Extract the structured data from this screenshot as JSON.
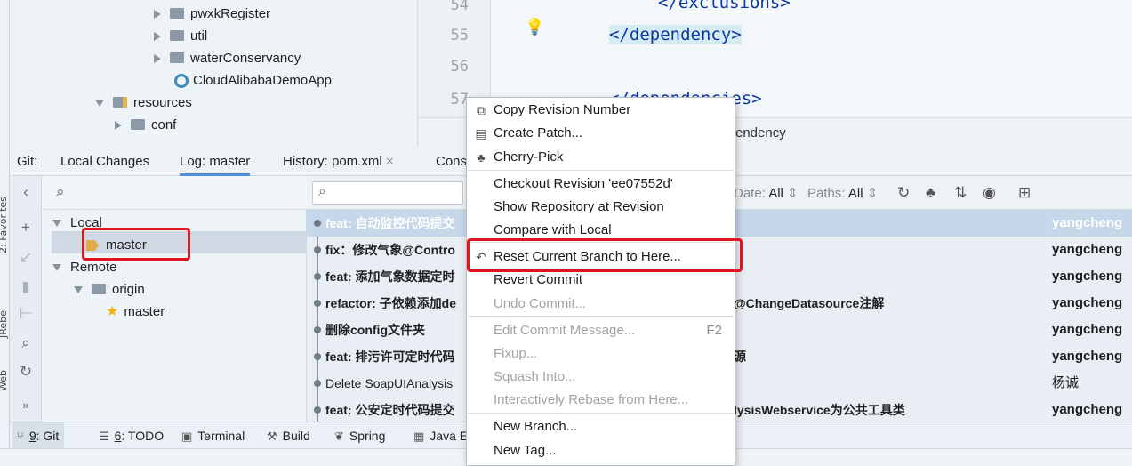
{
  "side_labels": {
    "favorites": "2: Favorites",
    "jrebel": "JRebel",
    "web": "Web"
  },
  "project_tree": [
    {
      "label": "pwxkRegister",
      "type": "folder"
    },
    {
      "label": "util",
      "type": "folder"
    },
    {
      "label": "waterConservancy",
      "type": "folder"
    },
    {
      "label": "CloudAlibabaDemoApp",
      "type": "class"
    },
    {
      "label": "resources",
      "type": "resources"
    },
    {
      "label": "conf",
      "type": "folder"
    }
  ],
  "editor": {
    "line_numbers": [
      "54",
      "55",
      "56",
      "57"
    ],
    "lines": [
      "</exclusions>",
      "</dependency>",
      "",
      "</dependencies>"
    ],
    "breadcrumb": "endency"
  },
  "git_tabs": {
    "prefix": "Git:",
    "tabs": [
      "Local Changes",
      "Log: master",
      "History: pom.xml",
      "Cons"
    ],
    "close": "×"
  },
  "branches": {
    "local_label": "Local",
    "local_master": "master",
    "remote_label": "Remote",
    "origin": "origin",
    "origin_master": "master"
  },
  "log_toolbar": {
    "date_label": "Date:",
    "date_value": "All",
    "paths_label": "Paths:",
    "paths_value": "All"
  },
  "commits": [
    {
      "msg": "feat: 自动监控代码提交",
      "tail": "",
      "author": "yangcheng",
      "bold": true
    },
    {
      "msg": "fix：修改气象@Contro",
      "tail": "",
      "author": "yangcheng",
      "bold": true
    },
    {
      "msg": "feat: 添加气象数据定时",
      "tail": "",
      "author": "yangcheng",
      "bold": true
    },
    {
      "msg": "refactor: 子依赖添加de",
      "tail": "@ChangeDatasource注解",
      "author": "yangcheng",
      "bold": true
    },
    {
      "msg": "删除config文件夹",
      "tail": "",
      "author": "yangcheng",
      "bold": true
    },
    {
      "msg": "feat: 排污许可定时代码",
      "tail": "源",
      "author": "yangcheng",
      "bold": true
    },
    {
      "msg": "Delete SoapUIAnalysis",
      "tail": "",
      "author": "杨诚",
      "bold": false
    },
    {
      "msg": "feat: 公安定时代码提交",
      "tail": "lysisWebservice为公共工具类",
      "author": "yangcheng",
      "bold": true
    }
  ],
  "context_menu": [
    {
      "label": "Copy Revision Number",
      "icon": "copy-icon",
      "enabled": true
    },
    {
      "label": "Create Patch...",
      "icon": "patch-icon",
      "enabled": true
    },
    {
      "label": "Cherry-Pick",
      "icon": "cherry-icon",
      "enabled": true
    },
    {
      "label": "Checkout Revision 'ee07552d'",
      "enabled": true
    },
    {
      "label": "Show Repository at Revision",
      "enabled": true
    },
    {
      "label": "Compare with Local",
      "enabled": true
    },
    {
      "label": "Reset Current Branch to Here...",
      "icon": "undo-icon",
      "enabled": true
    },
    {
      "label": "Revert Commit",
      "enabled": true
    },
    {
      "label": "Undo Commit...",
      "enabled": false
    },
    {
      "label": "Edit Commit Message...",
      "shortcut": "F2",
      "enabled": false
    },
    {
      "label": "Fixup...",
      "enabled": false
    },
    {
      "label": "Squash Into...",
      "enabled": false
    },
    {
      "label": "Interactively Rebase from Here...",
      "enabled": false
    },
    {
      "label": "New Branch...",
      "enabled": true
    },
    {
      "label": "New Tag...",
      "enabled": true
    }
  ],
  "bottom_tabs": [
    {
      "key": "9",
      "label": ": Git",
      "icon": "git-icon"
    },
    {
      "key": "6",
      "label": ": TODO",
      "icon": "todo-icon"
    },
    {
      "key": "",
      "label": "Terminal",
      "icon": "terminal-icon"
    },
    {
      "key": "",
      "label": "Build",
      "icon": "hammer-icon"
    },
    {
      "key": "",
      "label": "Spring",
      "icon": "spring-icon"
    },
    {
      "key": "",
      "label": "Java En",
      "icon": "java-icon"
    }
  ],
  "colors": {
    "highlight_box": "#e0141e",
    "accent": "#4d8ed6",
    "selected_row": "#c5d7e8"
  }
}
